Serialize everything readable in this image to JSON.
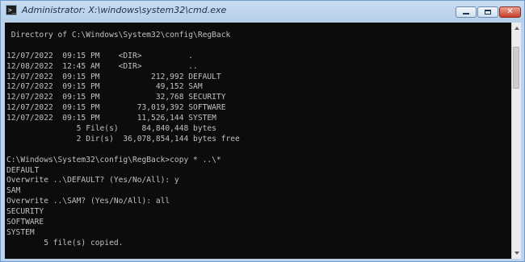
{
  "window": {
    "title": "Administrator: X:\\windows\\system32\\cmd.exe",
    "icon": "cmd-icon",
    "controls": [
      "minimize-icon",
      "maximize-icon",
      "close-icon"
    ]
  },
  "colors": {
    "console_background": "#0c0c0c",
    "console_text": "#c0c0c0",
    "titlebar": "#bcd3ec"
  },
  "console": {
    "lines": [
      " Directory of C:\\Windows\\System32\\config\\RegBack",
      "",
      "12/07/2022  09:15 PM    <DIR>          .",
      "12/08/2022  12:45 AM    <DIR>          ..",
      "12/07/2022  09:15 PM           212,992 DEFAULT",
      "12/07/2022  09:15 PM            49,152 SAM",
      "12/07/2022  09:15 PM            32,768 SECURITY",
      "12/07/2022  09:15 PM        73,019,392 SOFTWARE",
      "12/07/2022  09:15 PM        11,526,144 SYSTEM",
      "               5 File(s)     84,840,448 bytes",
      "               2 Dir(s)  36,078,854,144 bytes free",
      "",
      "C:\\Windows\\System32\\config\\RegBack>copy * ..\\*",
      "DEFAULT",
      "Overwrite ..\\DEFAULT? (Yes/No/All): y",
      "SAM",
      "Overwrite ..\\SAM? (Yes/No/All): all",
      "SECURITY",
      "SOFTWARE",
      "SYSTEM",
      "        5 file(s) copied."
    ]
  }
}
